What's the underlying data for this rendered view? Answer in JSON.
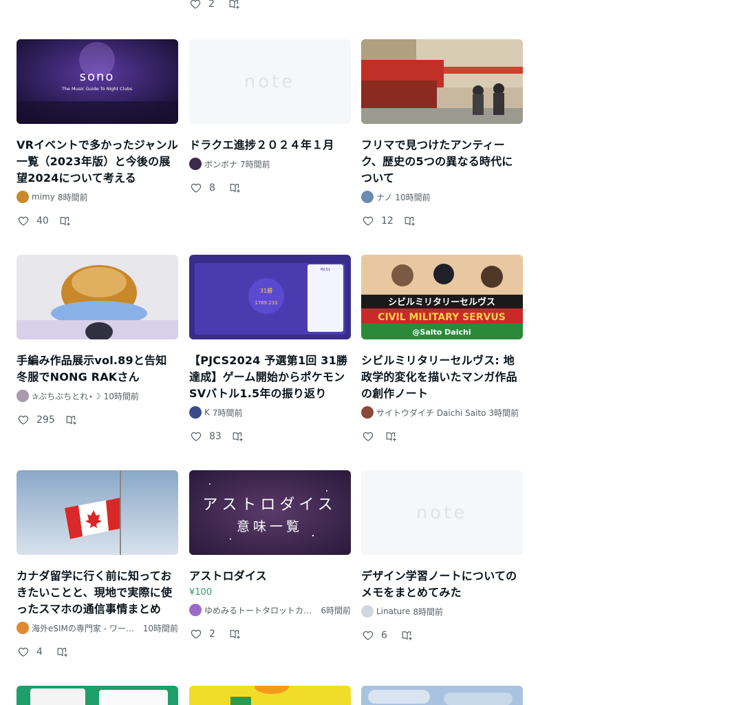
{
  "top_partial": {
    "likes": "2"
  },
  "cards": [
    {
      "title": "VRイベントで多かったジャンル一覧（2023年版）と今後の展望2024について考える",
      "author": "mimy",
      "time": "8時間前",
      "likes": "40",
      "thumb": "sono",
      "thumb_text": [
        "sono",
        "The Music Guide To Night Clubs"
      ],
      "avatar_color": "#c88a2a"
    },
    {
      "title": "ドラクエ進捗２０２４年１月",
      "author": "ボンボナ",
      "time": "7時間前",
      "likes": "8",
      "thumb": "note",
      "thumb_text": [
        "note"
      ],
      "avatar_color": "#3b2a4a"
    },
    {
      "title": "フリマで見つけたアンティーク、歴史の5つの異なる時代について",
      "author": "ナノ",
      "time": "10時間前",
      "likes": "12",
      "thumb": "market",
      "thumb_text": [],
      "avatar_color": "#6b8cb0"
    },
    {
      "title": "手編み作品展示vol.89と告知 冬服でNONG RAKさん",
      "author": "✰ぷちぷちとれ⋆☽",
      "time": "10時間前",
      "likes": "295",
      "thumb": "knit",
      "thumb_text": [],
      "avatar_color": "#a89aa8"
    },
    {
      "title": "【PJCS2024 予選第1回 31勝達成】ゲーム開始からポケモンSVバトル1.5年の振り返り",
      "author": "K",
      "time": "7時間前",
      "likes": "83",
      "thumb": "pjcs",
      "thumb_text": [
        "PJCS1",
        "31勝",
        "1769.233"
      ],
      "avatar_color": "#3a4a8a"
    },
    {
      "title": "シビルミリタリーセルヴス: 地政学的変化を描いたマンガ作品の創作ノート",
      "author": "サイトウダイチ Daichi Saito",
      "time": "3時間前",
      "likes": "",
      "thumb": "manga",
      "thumb_text": [
        "シビルミリタリーセルヴス",
        "CIVIL MILITARY SERVUS",
        "@Saito Daichi"
      ],
      "avatar_color": "#8a4a3a"
    },
    {
      "title": "カナダ留学に行く前に知っておきたいことと、現地で実際に使ったスマホの通信事情まとめ",
      "author": "海外eSIMの専門家 - ワールドeSIMサービス",
      "time": "10時間前",
      "likes": "4",
      "thumb": "canada",
      "thumb_text": [],
      "avatar_color": "#e08a30"
    },
    {
      "title": "アストロダイス",
      "price": "¥100",
      "author": "ゆめみるトートタロットカード",
      "time": "6時間前",
      "likes": "2",
      "thumb": "astro",
      "thumb_text": [
        "アストロダイス",
        "意味一覧"
      ],
      "avatar_color": "#9a6ac8"
    },
    {
      "title": "デザイン学習ノートについてのメモをまとめてみた",
      "author": "Linature",
      "time": "8時間前",
      "likes": "6",
      "thumb": "note",
      "thumb_text": [
        "note"
      ],
      "avatar_color": "#cfd8e0"
    }
  ],
  "icons": {
    "like": "heart-icon",
    "save": "magazine-add-icon"
  },
  "colors": {
    "price": "#2f9b66",
    "meta": "#555f66",
    "title": "#08131a"
  }
}
